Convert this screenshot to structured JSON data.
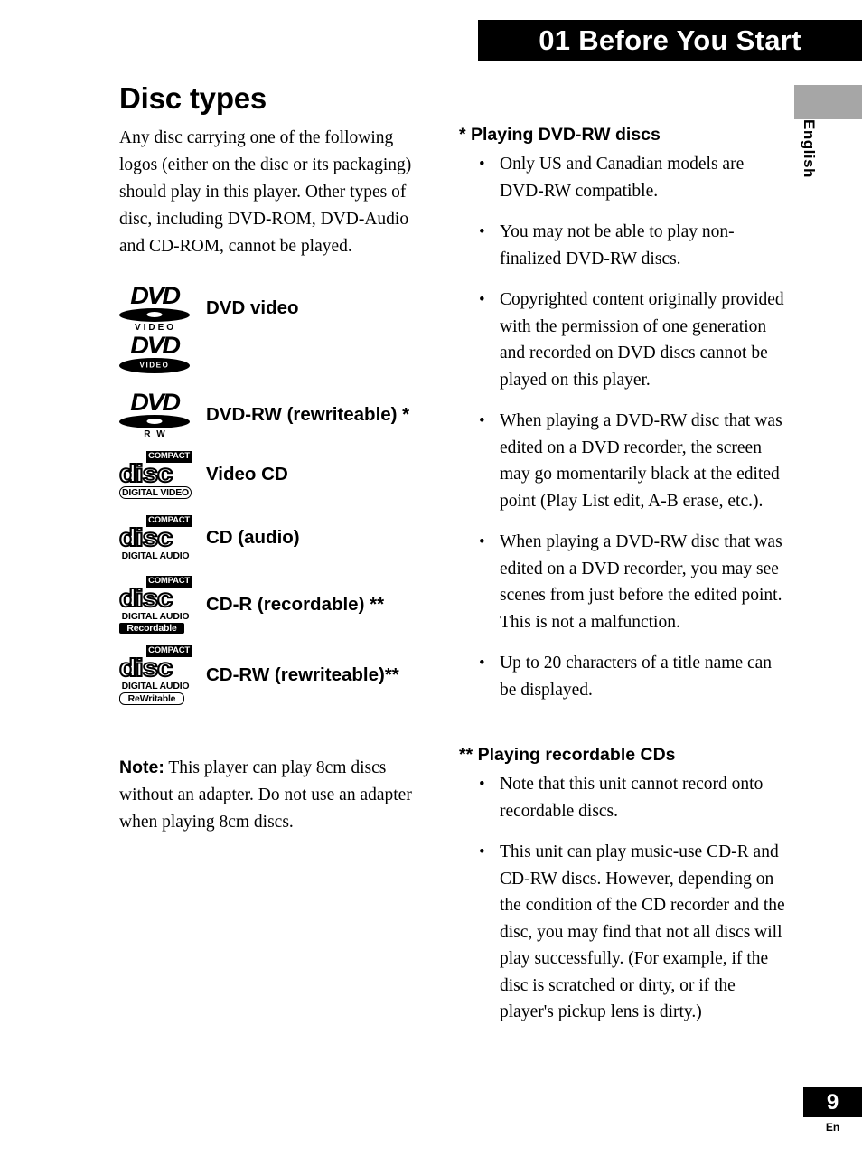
{
  "header": {
    "chapter_number": "01",
    "chapter_title": "Before You Start",
    "banner_text": "01  Before You Start",
    "banner_bg": "#000000",
    "banner_fg": "#ffffff"
  },
  "side_tab": {
    "language": "English",
    "tab_color": "#a6a6a6"
  },
  "left_column": {
    "title": "Disc types",
    "intro": "Any disc carrying one of the following logos (either on the disc or its packaging) should play in this player. Other types of disc, including DVD-ROM, DVD-Audio and CD-ROM, cannot be played.",
    "logos": [
      {
        "kind": "dvd",
        "word": "DVD",
        "sub": "VIDEO",
        "inner": "",
        "label": "DVD video",
        "label_visible": true
      },
      {
        "kind": "dvd-inner",
        "word": "DVD",
        "sub": "",
        "inner": "VIDEO",
        "label": "",
        "label_visible": false
      },
      {
        "kind": "dvd",
        "word": "DVD",
        "sub": "R W",
        "inner": "",
        "label": "DVD-RW (rewriteable) *",
        "label_visible": true
      },
      {
        "kind": "cd",
        "compact": "COMPACT",
        "disc": "disc",
        "bar1": "DIGITAL VIDEO",
        "bar1_style": "rounded-outline",
        "bar2": "",
        "bar2_style": "",
        "label": "Video CD",
        "label_visible": true
      },
      {
        "kind": "cd",
        "compact": "COMPACT",
        "disc": "disc",
        "bar1": "DIGITAL AUDIO",
        "bar1_style": "plain",
        "bar2": "",
        "bar2_style": "",
        "label": "CD (audio)",
        "label_visible": true
      },
      {
        "kind": "cd",
        "compact": "COMPACT",
        "disc": "disc",
        "bar1": "DIGITAL AUDIO",
        "bar1_style": "plain",
        "bar2": "Recordable",
        "bar2_style": "boxed-solid",
        "label": "CD-R (recordable) **",
        "label_visible": true
      },
      {
        "kind": "cd",
        "compact": "COMPACT",
        "disc": "disc",
        "bar1": "DIGITAL AUDIO",
        "bar1_style": "plain",
        "bar2": "ReWritable",
        "bar2_style": "boxed-outline",
        "label": "CD-RW (rewriteable)**",
        "label_visible": true
      }
    ],
    "note_lead": "Note:",
    "note_text": " This player can play 8cm discs without an adapter. Do not use an adapter when playing 8cm discs."
  },
  "right_column": {
    "sections": [
      {
        "marker": "*",
        "heading": "Playing DVD-RW discs",
        "heading_full": "* Playing DVD-RW discs",
        "bullets": [
          "Only US and Canadian models are DVD-RW compatible.",
          "You may not be able to play non-finalized DVD-RW discs.",
          "Copyrighted content originally provided with the permission of one generation and recorded on DVD discs cannot be played on this player.",
          "When playing a DVD-RW disc that was edited on a DVD recorder, the screen may go momentarily black at the edited point (Play List edit, A-B erase, etc.).",
          "When playing a DVD-RW disc that was edited on a DVD recorder, you may see scenes from just before the edited point. This is not a malfunction.",
          "Up to 20 characters of a title name can be displayed."
        ]
      },
      {
        "marker": "**",
        "heading": "Playing recordable CDs",
        "heading_full": "** Playing recordable CDs",
        "bullets": [
          "Note that this unit cannot record onto recordable discs.",
          "This unit can play music-use CD-R and CD-RW discs. However, depending on the condition of the CD recorder and the disc, you may find that not all discs will play successfully. (For example, if the disc is scratched or dirty, or if the player's pickup lens is dirty.)"
        ]
      }
    ],
    "bullet_glyph": "•"
  },
  "footer": {
    "page_number": "9",
    "language_code": "En"
  }
}
